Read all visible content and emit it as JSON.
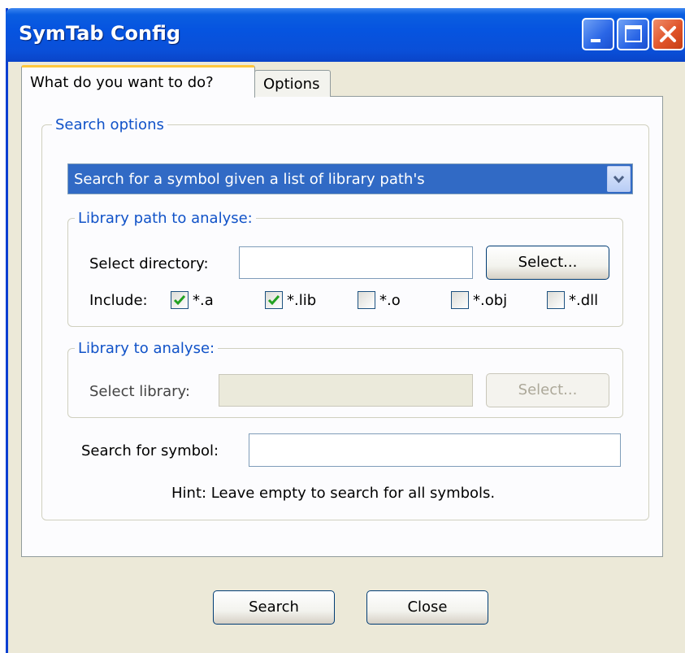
{
  "window": {
    "title": "SymTab Config"
  },
  "tabs": [
    {
      "label": "What do you want to do?",
      "active": true
    },
    {
      "label": "Options",
      "active": false
    }
  ],
  "search_options": {
    "legend": "Search options",
    "mode_selected": "Search for a symbol given a list of library path's"
  },
  "library_path": {
    "legend": "Library path to analyse:",
    "directory_label": "Select directory:",
    "directory_value": "",
    "select_button": "Select...",
    "include_label": "Include:",
    "filters": [
      {
        "label": "*.a",
        "checked": true
      },
      {
        "label": "*.lib",
        "checked": true
      },
      {
        "label": "*.o",
        "checked": false
      },
      {
        "label": "*.obj",
        "checked": false
      },
      {
        "label": "*.dll",
        "checked": false
      }
    ]
  },
  "library": {
    "legend": "Library to analyse:",
    "library_label": "Select library:",
    "library_value": "",
    "select_button": "Select..."
  },
  "symbol": {
    "label": "Search for symbol:",
    "value": "",
    "hint": "Hint: Leave empty to search for all symbols."
  },
  "buttons": {
    "search": "Search",
    "close": "Close"
  },
  "colors": {
    "title_bar": "#0654e0",
    "selection": "#316ac5",
    "legend": "#1052c8",
    "tab_highlight": "#ffc73c"
  }
}
